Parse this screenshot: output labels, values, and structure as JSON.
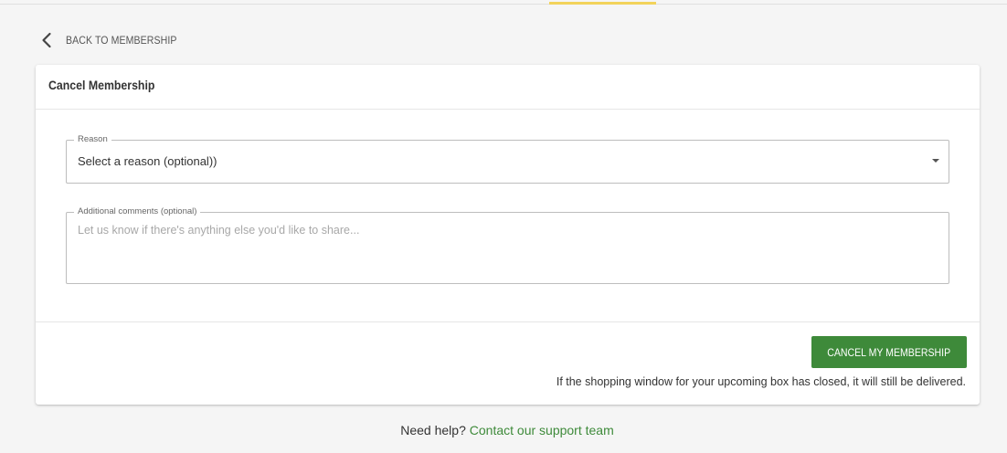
{
  "nav": {
    "back_label": "BACK TO MEMBERSHIP"
  },
  "card": {
    "title": "Cancel Membership",
    "reason": {
      "label": "Reason",
      "selected": "Select a reason (optional))"
    },
    "comments": {
      "label": "Additional comments (optional)",
      "placeholder": "Let us know if there's anything else you'd like to share..."
    },
    "cancel_button": "CANCEL MY MEMBERSHIP",
    "notice": "If the shopping window for your upcoming box has closed, it will still be delivered."
  },
  "help": {
    "prefix": "Need help?",
    "link": "Contact our support team"
  },
  "colors": {
    "accent_green": "#3e8a3a",
    "top_accent_yellow": "#f2d35a",
    "page_background": "#f5f5f5"
  },
  "icons": {
    "back": "chevron-left-icon",
    "dropdown": "caret-down-icon"
  }
}
